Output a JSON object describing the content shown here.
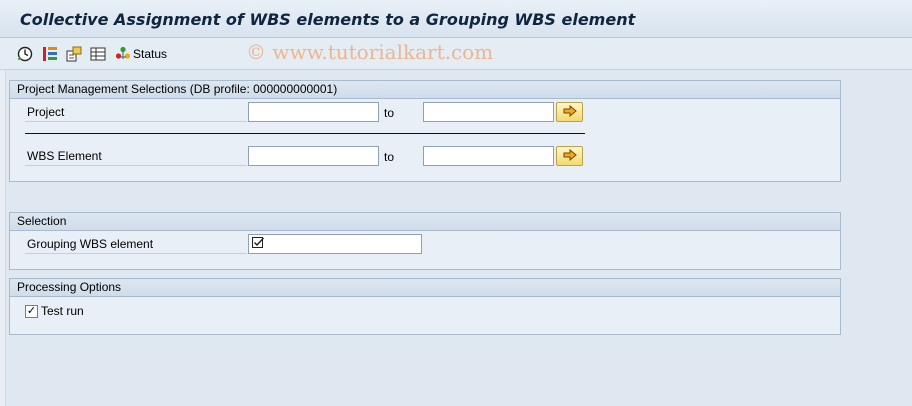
{
  "title": "Collective Assignment of WBS elements to a Grouping WBS element",
  "watermark": "© www.tutorialkart.com",
  "toolbar": {
    "buttons": [
      {
        "icon": "execute-icon",
        "label": ""
      },
      {
        "icon": "variant-icon",
        "label": ""
      },
      {
        "icon": "get-variant-icon",
        "label": ""
      },
      {
        "icon": "layout-icon",
        "label": ""
      },
      {
        "icon": "status-icon",
        "label": "Status"
      }
    ]
  },
  "groups": {
    "project_mgmt": {
      "header": "Project Management Selections (DB profile: 000000000001)",
      "project": {
        "label": "Project",
        "from_value": "",
        "to_label": "to",
        "to_value": ""
      },
      "wbs": {
        "label": "WBS Element",
        "from_value": "",
        "to_label": "to",
        "to_value": ""
      }
    },
    "selection": {
      "header": "Selection",
      "grouping": {
        "label": "Grouping WBS element",
        "value": "",
        "required": true
      }
    },
    "processing": {
      "header": "Processing Options",
      "test_run": {
        "label": "Test run",
        "checked": true,
        "mark": "✓"
      }
    }
  },
  "colors": {
    "background": "#dfe8f1",
    "group_border": "#a8bacc",
    "title_text": "#10253f",
    "multi_button": "#f3d970"
  }
}
